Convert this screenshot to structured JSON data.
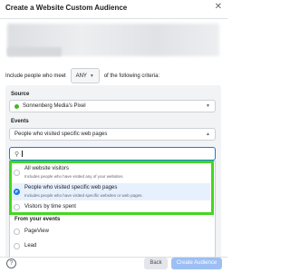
{
  "dialog": {
    "title": "Create a Website Custom Audience"
  },
  "criteria": {
    "prefix": "Include people who meet",
    "any": "ANY",
    "suffix": "of the following criteria:"
  },
  "source": {
    "label": "Source",
    "value": "Sonnenberg Media's Pixel"
  },
  "events": {
    "label": "Events",
    "value": "People who visited specific web pages"
  },
  "dropdown": {
    "options": [
      {
        "title": "All website visitors",
        "sub": "Includes people who have visited any of your websites."
      },
      {
        "title": "People who visited specific web pages",
        "sub": "Includes people who have visited specific websites or web pages."
      },
      {
        "title": "Visitors by time spent",
        "sub": ""
      }
    ],
    "section": "From your events",
    "events": [
      {
        "title": "PageView"
      },
      {
        "title": "Lead"
      }
    ]
  },
  "footer": {
    "help": "?",
    "back": "Back",
    "create": "Create Audience"
  },
  "colors": {
    "accent": "#1877f2",
    "highlight": "#42d71e",
    "selected_row": "#e7f0fd",
    "disabled_button": "#9cbff4"
  }
}
